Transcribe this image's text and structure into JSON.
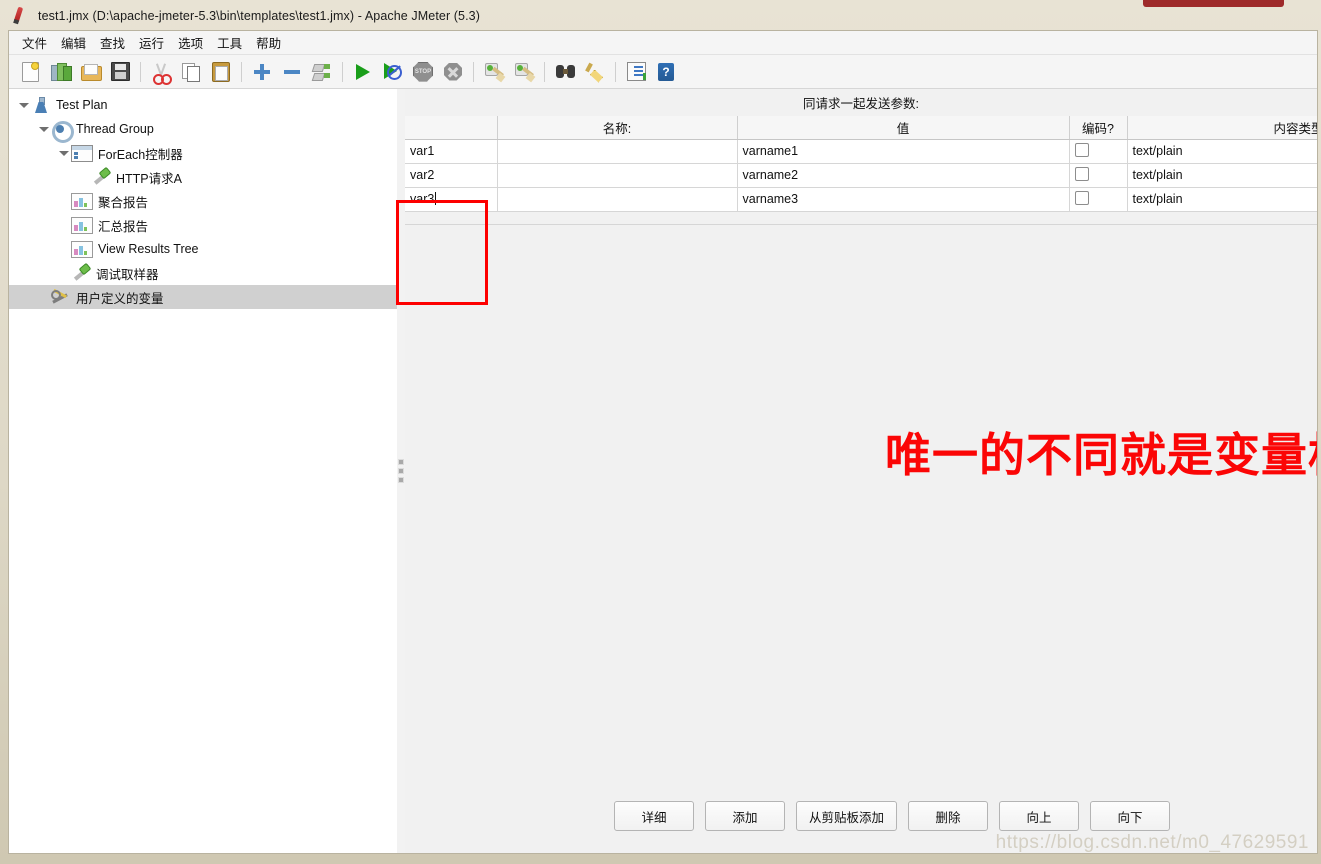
{
  "window": {
    "title": "test1.jmx (D:\\apache-jmeter-5.3\\bin\\templates\\test1.jmx) - Apache JMeter (5.3)",
    "app_icon": "jmeter-feather-icon"
  },
  "menu": {
    "items": [
      {
        "label": "文件",
        "name": "menu-file"
      },
      {
        "label": "编辑",
        "name": "menu-edit"
      },
      {
        "label": "查找",
        "name": "menu-search"
      },
      {
        "label": "运行",
        "name": "menu-run"
      },
      {
        "label": "选项",
        "name": "menu-options"
      },
      {
        "label": "工具",
        "name": "menu-tools"
      },
      {
        "label": "帮助",
        "name": "menu-help"
      }
    ]
  },
  "toolbar": {
    "icons": [
      "new-document-icon",
      "templates-icon",
      "open-folder-icon",
      "save-icon",
      "cut-icon",
      "copy-icon",
      "paste-icon",
      "expand-all-icon",
      "collapse-all-icon",
      "toggle-icon",
      "start-icon",
      "start-no-timers-icon",
      "stop-icon",
      "shutdown-icon",
      "clear-icon",
      "clear-all-icon",
      "search-icon",
      "search-reset-icon",
      "function-helper-icon",
      "help-icon"
    ]
  },
  "tree": {
    "nodes": [
      {
        "label": "Test Plan",
        "icon": "test-plan-icon",
        "indent": 0,
        "expanded": true,
        "selected": false
      },
      {
        "label": "Thread Group",
        "icon": "thread-group-icon",
        "indent": 1,
        "expanded": true,
        "selected": false
      },
      {
        "label": "ForEach控制器",
        "icon": "controller-icon",
        "indent": 2,
        "expanded": true,
        "selected": false
      },
      {
        "label": "HTTP请求A",
        "icon": "http-sampler-icon",
        "indent": 3,
        "expanded": false,
        "selected": false
      },
      {
        "label": "聚合报告",
        "icon": "listener-icon",
        "indent": 2,
        "expanded": false,
        "selected": false
      },
      {
        "label": "汇总报告",
        "icon": "listener-icon",
        "indent": 2,
        "expanded": false,
        "selected": false
      },
      {
        "label": "View Results Tree",
        "icon": "listener-icon",
        "indent": 2,
        "expanded": false,
        "selected": false
      },
      {
        "label": "调试取样器",
        "icon": "http-sampler-icon",
        "indent": 2,
        "expanded": false,
        "selected": false
      },
      {
        "label": "用户定义的变量",
        "icon": "config-element-icon",
        "indent": 1,
        "expanded": false,
        "selected": true
      }
    ]
  },
  "panel": {
    "heading": "同请求一起发送参数:",
    "table": {
      "columns": [
        "",
        "名称:",
        "值",
        "编码?",
        "内容类型"
      ],
      "rows": [
        {
          "blank": "",
          "name": "var1",
          "value": "varname1",
          "encode": false,
          "content_type": "text/plain"
        },
        {
          "blank": "",
          "name": "var2",
          "value": "varname2",
          "encode": false,
          "content_type": "text/plain"
        },
        {
          "blank": "",
          "name": "var3",
          "value": "var3",
          "value_real": "varname3",
          "encode": false,
          "content_type": "text/plain",
          "editing": true
        }
      ],
      "cell_values": {
        "r1c1": "var1",
        "r2c1": "var2",
        "r3c1": "var3",
        "r1c3": "varname1",
        "r2c3": "varname2",
        "r3c3": "varname3",
        "r1c5": "text/plain",
        "r2c5": "text/plain",
        "r3c5": "text/plain"
      }
    }
  },
  "annotation": {
    "text": "唯一的不同就是变量格式没有下划线",
    "color": "#fb0606"
  },
  "buttons": [
    {
      "label": "详细",
      "name": "detail-button"
    },
    {
      "label": "添加",
      "name": "add-button"
    },
    {
      "label": "从剪贴板添加",
      "name": "add-from-clipboard-button"
    },
    {
      "label": "删除",
      "name": "delete-button"
    },
    {
      "label": "向上",
      "name": "move-up-button"
    },
    {
      "label": "向下",
      "name": "move-down-button"
    }
  ],
  "watermark": "https://blog.csdn.net/m0_47629591"
}
